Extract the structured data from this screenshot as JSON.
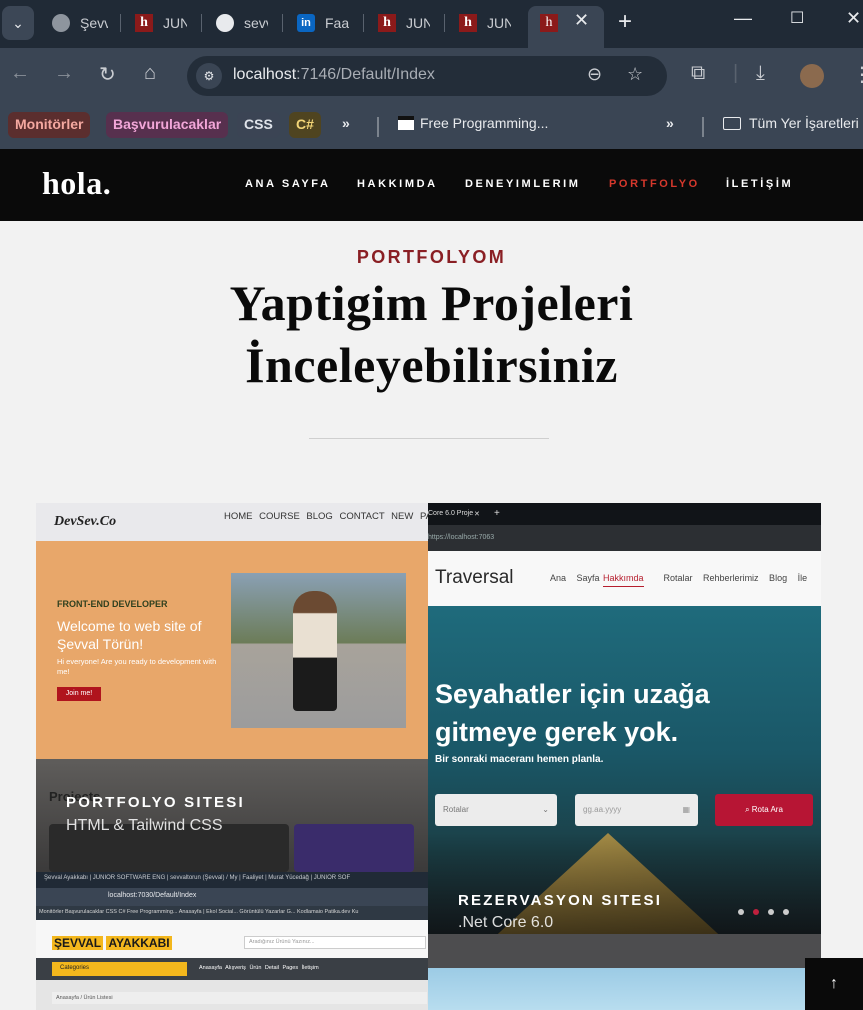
{
  "browser": {
    "tabs": [
      {
        "title": "Şevv",
        "icon": "globe-icon"
      },
      {
        "title": "JUN",
        "icon": "h-icon"
      },
      {
        "title": "sevv",
        "icon": "github-icon"
      },
      {
        "title": "Faa",
        "icon": "linkedin-icon"
      },
      {
        "title": "JUN",
        "icon": "h-icon"
      },
      {
        "title": "JUN",
        "icon": "h-icon"
      }
    ],
    "url_host": "localhost",
    "url_path": ":7146/Default/Index",
    "bookmarks": {
      "chips": [
        {
          "label": "Monitörler",
          "bg": "#5b2e2e",
          "fg": "#f4a8a0"
        },
        {
          "label": "Başvurulacaklar",
          "bg": "#57304e",
          "fg": "#f2a6d8"
        },
        {
          "label": "CSS",
          "bg": "#3b4454",
          "fg": "#dfe3ea"
        },
        {
          "label": "C#",
          "bg": "#4f4420",
          "fg": "#f3d577"
        }
      ],
      "item": "Free Programming...",
      "folder": "Tüm Yer İşaretleri"
    }
  },
  "site": {
    "logo": "hola.",
    "nav": [
      "ANA SAYFA",
      "HAKKIMDA",
      "DENEYIMLERIM",
      "PORTFOLYO",
      "İLETİŞİM"
    ],
    "active_nav": "PORTFOLYO",
    "accent": "#d6382c"
  },
  "section": {
    "eyebrow": "PORTFOLYOM",
    "headline": "Yaptigim Projeleri İnceleyebilirsiniz"
  },
  "projects": [
    {
      "title": "PORTFOLYO SITESI",
      "subtitle": "HTML & Tailwind CSS",
      "preview": {
        "logo": "DevSev.Co",
        "links": "HOME COURSE BLOG CONTACT NEW PAGE",
        "kicker": "FRONT-END DEVELOPER",
        "welcome": "Welcome to web site of Şevval Törün!",
        "small": "Hi everyone! Are you ready to development with me!",
        "button": "Join me!",
        "section": "Projects"
      }
    },
    {
      "title": "REZERVASYON SITESI",
      "subtitle": ".Net Core 6.0",
      "preview": {
        "tab": "Core 6.0 Proje",
        "url": "https://localhost:7063",
        "logo": "Traversal",
        "links_before": "Ana Sayfa",
        "active_link": "Hakkımda",
        "links_after": "Rotalar Rehberlerimiz Blog İle",
        "hero_line1": "Seyahatler için uzağa",
        "hero_line2": "gitmeye gerek yok.",
        "hero_sub": "Bir sonraki maceranı hemen planla.",
        "select": "Rotalar",
        "date_placeholder": "gg.aa.yyyy",
        "button": "Rota Ara"
      }
    },
    {
      "preview": {
        "tabs": "Şevval Ayakkabı | JUNIOR SOFTWARE ENG | sevvaltorun (Şevval) / My | Faaliyet | Murat Yücedağ | JUNIOR SOF",
        "url": "localhost:7030/Default/Index",
        "bookmarks": "Monitörler  Başvurulacaklar  CSS  C#  Free Programming...  Anasayfa | Ekol Social...  Görüntülü Yazarlar G...  Kodlamaio  Patika.dev  Ku",
        "logo_a": "ŞEVVAL",
        "logo_b": "AYAKKABI",
        "search": "Aradığınız Ürünü Yazınız...",
        "category": "Categories",
        "links": "Anasayfa  Alışveriş  Ürün Detail  Pages  İletişim",
        "crumb": "Anasayfa  /  Ürün Listesi"
      }
    }
  ]
}
